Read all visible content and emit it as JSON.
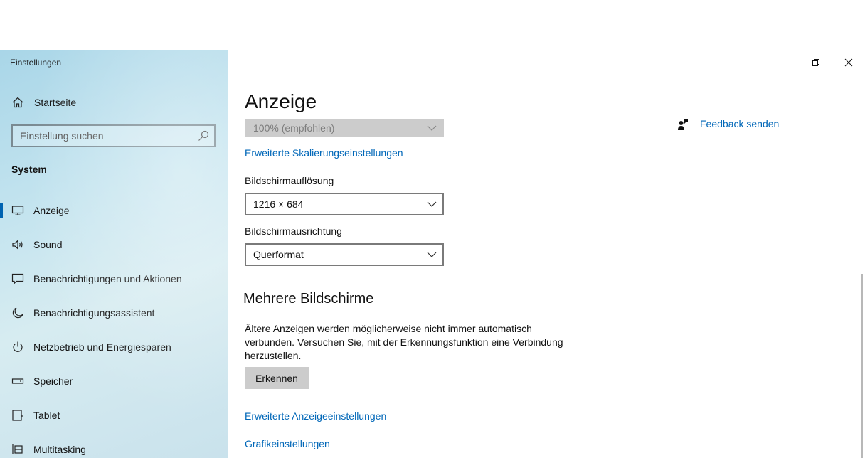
{
  "window": {
    "app_title": "Einstellungen"
  },
  "sidebar": {
    "home_label": "Startseite",
    "search_placeholder": "Einstellung suchen",
    "section_label": "System",
    "items": [
      {
        "label": "Anzeige",
        "icon": "monitor-icon",
        "active": true
      },
      {
        "label": "Sound",
        "icon": "speaker-icon"
      },
      {
        "label": "Benachrichtigungen und Aktionen",
        "icon": "notification-icon"
      },
      {
        "label": "Benachrichtigungsassistent",
        "icon": "moon-icon"
      },
      {
        "label": "Netzbetrieb und Energiesparen",
        "icon": "power-icon"
      },
      {
        "label": "Speicher",
        "icon": "storage-icon"
      },
      {
        "label": "Tablet",
        "icon": "tablet-icon"
      },
      {
        "label": "Multitasking",
        "icon": "multitasking-icon"
      }
    ]
  },
  "main": {
    "title": "Anzeige",
    "scale_value": "100% (empfohlen)",
    "advanced_scaling_link": "Erweiterte Skalierungseinstellungen",
    "resolution_label": "Bildschirmauflösung",
    "resolution_value": "1216 × 684",
    "orientation_label": "Bildschirmausrichtung",
    "orientation_value": "Querformat",
    "multi_display_heading": "Mehrere Bildschirme",
    "multi_display_text": "Ältere Anzeigen werden möglicherweise nicht immer automatisch verbunden. Versuchen Sie, mit der Erkennungsfunktion eine Verbindung herzustellen.",
    "detect_button": "Erkennen",
    "advanced_display_link": "Erweiterte Anzeigeeinstellungen",
    "graphics_link": "Grafikeinstellungen"
  },
  "feedback": {
    "label": "Feedback senden"
  },
  "colors": {
    "accent": "#0067b8",
    "active_indicator": "#0063b1"
  }
}
